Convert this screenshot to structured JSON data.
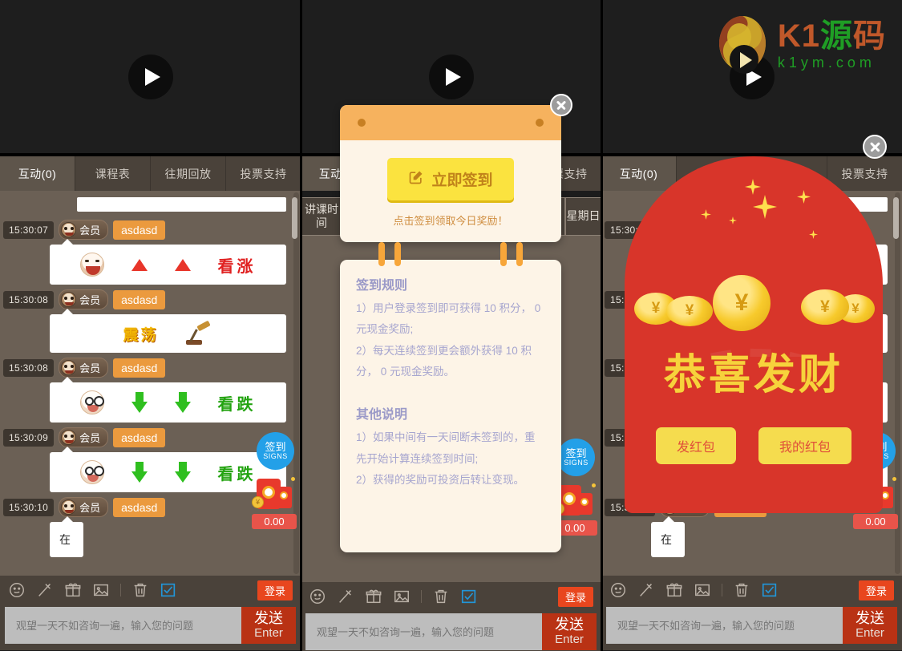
{
  "logo": {
    "brand_cn": "K1源码",
    "domain": "k1ym.com",
    "color_orange": "#c0582a",
    "color_green": "#1f9e25"
  },
  "tabs": [
    {
      "label": "互动(0)",
      "active": true
    },
    {
      "label": "课程表",
      "active": false
    },
    {
      "label": "往期回放",
      "active": false
    },
    {
      "label": "投票支持",
      "active": false
    }
  ],
  "chat": {
    "messages": [
      {
        "time": "15:30:07",
        "rank": "会员",
        "user": "asdasd",
        "kind": "signal",
        "signal": "看涨",
        "direction": "up",
        "emoji": "laugh-emoji"
      },
      {
        "time": "15:30:08",
        "rank": "会员",
        "user": "asdasd",
        "kind": "shock",
        "signal": "震荡",
        "emoji": "hammer-icon"
      },
      {
        "time": "15:30:08",
        "rank": "会员",
        "user": "asdasd",
        "kind": "signal",
        "signal": "看跌",
        "direction": "down",
        "emoji": "cry-emoji"
      },
      {
        "time": "15:30:09",
        "rank": "会员",
        "user": "asdasd",
        "kind": "signal",
        "signal": "看跌",
        "direction": "down",
        "emoji": "cry-emoji"
      },
      {
        "time": "15:30:10",
        "rank": "会员",
        "user": "asdasd",
        "kind": "text",
        "text": "在"
      }
    ]
  },
  "floating": {
    "signs_cn": "签到",
    "signs_en": "SIGNS",
    "redpack_amount": "0.00"
  },
  "toolbar": {
    "icons": [
      "emoji-icon",
      "magic-wand-icon",
      "gift-icon",
      "image-icon",
      "trash-icon",
      "checkbox-icon"
    ],
    "login_label": "登录"
  },
  "input": {
    "placeholder": "观望一天不如咨询一遍，输入您的问题",
    "value": "",
    "send_cn": "发送",
    "send_en": "Enter"
  },
  "schedule": {
    "col_time": "讲课时间",
    "col_day": "星期日"
  },
  "signin_modal": {
    "button_label": "立即签到",
    "button_icon": "pencil-square-icon",
    "tip": "点击签到领取今日奖励！",
    "rules_title": "签到规则",
    "rules": [
      "1）用户登录签到即可获得 10 积分， 0 元现金奖励;",
      "2）每天连续签到更会额外获得 10 积分， 0 元现金奖励。"
    ],
    "other_title": "其他说明",
    "other": [
      "1）如果中间有一天间断未签到的，重先开始计算连续签到时间;",
      "2）获得的奖励可投资后转让变现。"
    ],
    "close_icon": "close-icon",
    "accent": "#f6b25e",
    "button_color": "#fbe33f"
  },
  "redpacket_modal": {
    "greeting": "恭喜发财",
    "send_label": "发红包",
    "mine_label": "我的红包",
    "close_icon": "close-icon",
    "envelope_color": "#d8352a",
    "button_color": "#f5dc4e"
  },
  "video": {
    "play_icon": "play-icon"
  }
}
